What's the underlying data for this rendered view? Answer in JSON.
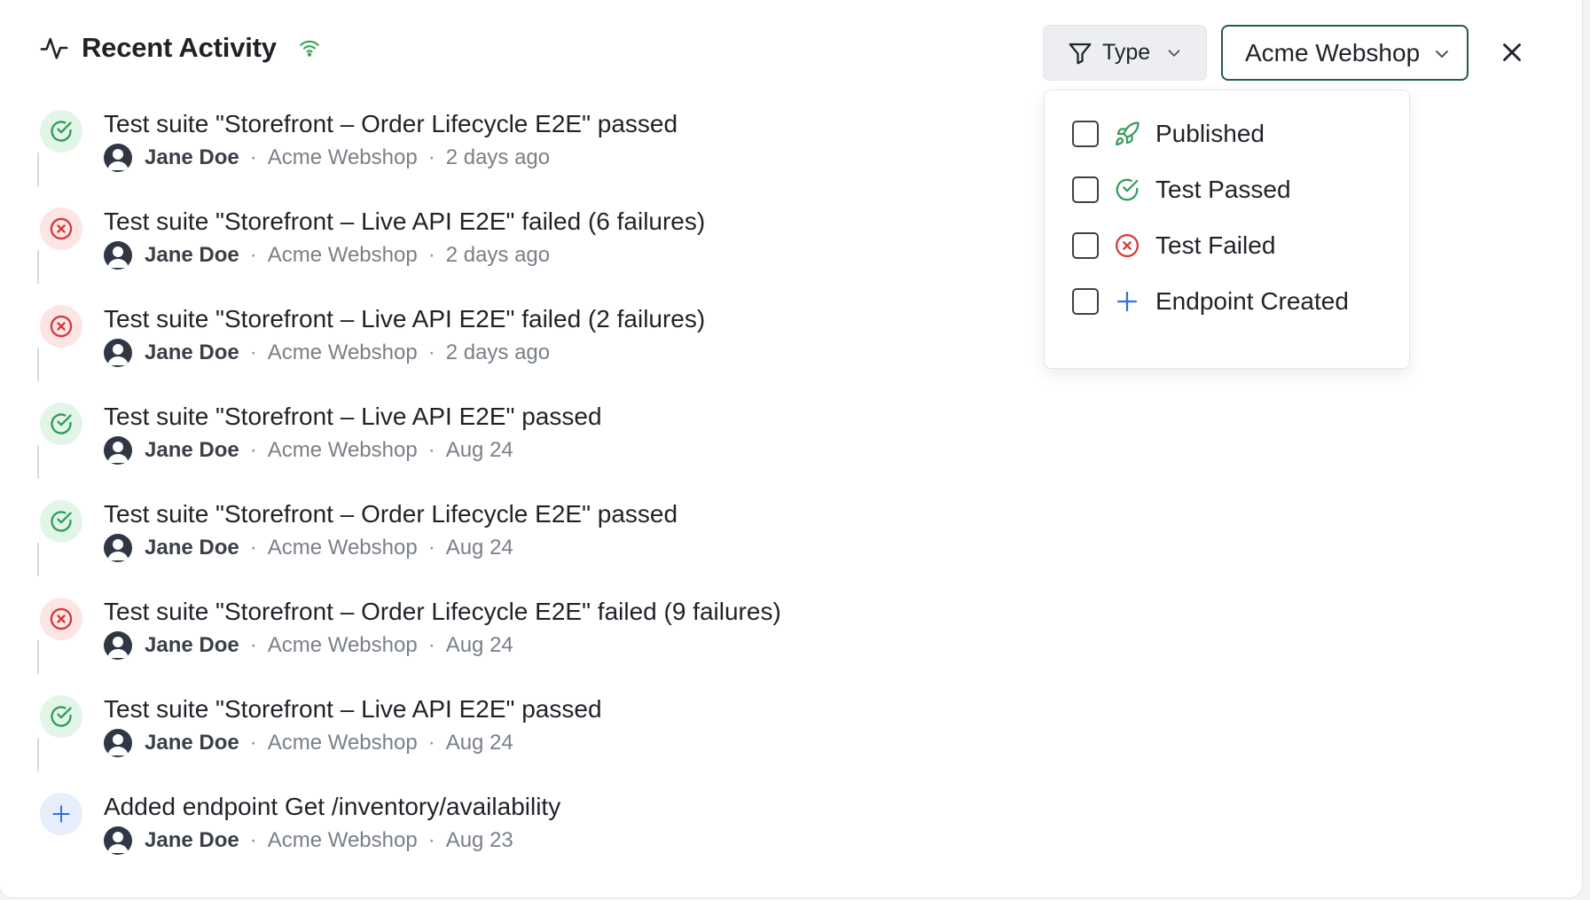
{
  "header": {
    "title": "Recent Activity"
  },
  "toolbar": {
    "type_label": "Type",
    "project_value": "Acme Webshop"
  },
  "filter_options": [
    {
      "label": "Published",
      "icon": "rocket-icon",
      "checked": false
    },
    {
      "label": "Test Passed",
      "icon": "check-circle-icon",
      "checked": false
    },
    {
      "label": "Test Failed",
      "icon": "x-circle-icon",
      "checked": false
    },
    {
      "label": "Endpoint Created",
      "icon": "plus-icon",
      "checked": false
    }
  ],
  "activities": [
    {
      "status": "pass",
      "title": "Test suite \"Storefront – Order Lifecycle E2E\" passed",
      "user": "Jane Doe",
      "project": "Acme Webshop",
      "time": "2 days ago"
    },
    {
      "status": "fail",
      "title": "Test suite \"Storefront – Live API E2E\" failed (6 failures)",
      "user": "Jane Doe",
      "project": "Acme Webshop",
      "time": "2 days ago"
    },
    {
      "status": "fail",
      "title": "Test suite \"Storefront – Live API E2E\" failed (2 failures)",
      "user": "Jane Doe",
      "project": "Acme Webshop",
      "time": "2 days ago"
    },
    {
      "status": "pass",
      "title": "Test suite \"Storefront – Live API E2E\" passed",
      "user": "Jane Doe",
      "project": "Acme Webshop",
      "time": "Aug 24"
    },
    {
      "status": "pass",
      "title": "Test suite \"Storefront – Order Lifecycle E2E\" passed",
      "user": "Jane Doe",
      "project": "Acme Webshop",
      "time": "Aug 24"
    },
    {
      "status": "fail",
      "title": "Test suite \"Storefront – Order Lifecycle E2E\" failed (9 failures)",
      "user": "Jane Doe",
      "project": "Acme Webshop",
      "time": "Aug 24"
    },
    {
      "status": "pass",
      "title": "Test suite \"Storefront – Live API E2E\" passed",
      "user": "Jane Doe",
      "project": "Acme Webshop",
      "time": "Aug 24"
    },
    {
      "status": "add",
      "title": "Added endpoint Get /inventory/availability",
      "user": "Jane Doe",
      "project": "Acme Webshop",
      "time": "Aug 23"
    }
  ],
  "colors": {
    "pass": "#2e9d57",
    "fail": "#d23a3a",
    "add": "#2f6fe0",
    "accent": "#1f5f46",
    "published": "#3a9a5b"
  }
}
